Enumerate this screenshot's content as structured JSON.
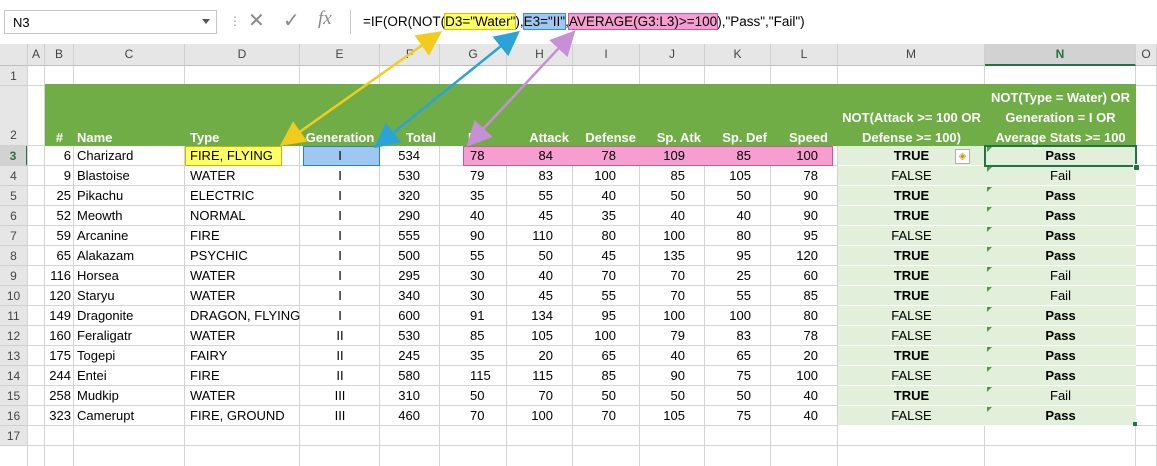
{
  "namebox": "N3",
  "formula": {
    "p0": "=IF(OR(NOT(",
    "p1": "D3=\"Water\"",
    "p2": "),",
    "p3": "E3=\"II\"",
    "p4": ",",
    "p5": "AVERAGE(G3:L3)>=100",
    "p6": "),\"Pass\",\"Fail\")"
  },
  "columns": [
    "A",
    "B",
    "C",
    "D",
    "E",
    "F",
    "G",
    "H",
    "I",
    "J",
    "K",
    "L",
    "M",
    "N",
    "O"
  ],
  "row_numbers": [
    "1",
    "2",
    "3",
    "4",
    "5",
    "6",
    "7",
    "8",
    "9",
    "10",
    "11",
    "12",
    "13",
    "14",
    "15",
    "16",
    "17"
  ],
  "headers": {
    "num": "#",
    "name": "Name",
    "type": "Type",
    "generation": "Generation",
    "total": "Total",
    "hp": "HP",
    "attack": "Attack",
    "defense": "Defense",
    "spatk": "Sp. Atk",
    "spdef": "Sp. Def",
    "speed": "Speed",
    "m_l1": "NOT(Attack >= 100 OR",
    "m_l2": "Defense >= 100)",
    "n_l1": "NOT(Type = Water) OR",
    "n_l2": "Generation = I OR",
    "n_l3": "Average Stats >= 100"
  },
  "rows": [
    {
      "num": "6",
      "name": "Charizard",
      "type": "FIRE, FLYING",
      "gen": "I",
      "total": "534",
      "hp": "78",
      "atk": "84",
      "def": "78",
      "spatk": "109",
      "spdef": "85",
      "speed": "100",
      "m": "TRUE",
      "n": "Pass"
    },
    {
      "num": "9",
      "name": "Blastoise",
      "type": "WATER",
      "gen": "I",
      "total": "530",
      "hp": "79",
      "atk": "83",
      "def": "100",
      "spatk": "85",
      "spdef": "105",
      "speed": "78",
      "m": "FALSE",
      "n": "Fail"
    },
    {
      "num": "25",
      "name": "Pikachu",
      "type": "ELECTRIC",
      "gen": "I",
      "total": "320",
      "hp": "35",
      "atk": "55",
      "def": "40",
      "spatk": "50",
      "spdef": "50",
      "speed": "90",
      "m": "TRUE",
      "n": "Pass"
    },
    {
      "num": "52",
      "name": "Meowth",
      "type": "NORMAL",
      "gen": "I",
      "total": "290",
      "hp": "40",
      "atk": "45",
      "def": "35",
      "spatk": "40",
      "spdef": "40",
      "speed": "90",
      "m": "TRUE",
      "n": "Pass"
    },
    {
      "num": "59",
      "name": "Arcanine",
      "type": "FIRE",
      "gen": "I",
      "total": "555",
      "hp": "90",
      "atk": "110",
      "def": "80",
      "spatk": "100",
      "spdef": "80",
      "speed": "95",
      "m": "FALSE",
      "n": "Pass"
    },
    {
      "num": "65",
      "name": "Alakazam",
      "type": "PSYCHIC",
      "gen": "I",
      "total": "500",
      "hp": "55",
      "atk": "50",
      "def": "45",
      "spatk": "135",
      "spdef": "95",
      "speed": "120",
      "m": "TRUE",
      "n": "Pass"
    },
    {
      "num": "116",
      "name": "Horsea",
      "type": "WATER",
      "gen": "I",
      "total": "295",
      "hp": "30",
      "atk": "40",
      "def": "70",
      "spatk": "70",
      "spdef": "25",
      "speed": "60",
      "m": "TRUE",
      "n": "Fail"
    },
    {
      "num": "120",
      "name": "Staryu",
      "type": "WATER",
      "gen": "I",
      "total": "340",
      "hp": "30",
      "atk": "45",
      "def": "55",
      "spatk": "70",
      "spdef": "55",
      "speed": "85",
      "m": "TRUE",
      "n": "Fail"
    },
    {
      "num": "149",
      "name": "Dragonite",
      "type": "DRAGON, FLYING",
      "gen": "I",
      "total": "600",
      "hp": "91",
      "atk": "134",
      "def": "95",
      "spatk": "100",
      "spdef": "100",
      "speed": "80",
      "m": "FALSE",
      "n": "Pass"
    },
    {
      "num": "160",
      "name": "Feraligatr",
      "type": "WATER",
      "gen": "II",
      "total": "530",
      "hp": "85",
      "atk": "105",
      "def": "100",
      "spatk": "79",
      "spdef": "83",
      "speed": "78",
      "m": "FALSE",
      "n": "Pass"
    },
    {
      "num": "175",
      "name": "Togepi",
      "type": "FAIRY",
      "gen": "II",
      "total": "245",
      "hp": "35",
      "atk": "20",
      "def": "65",
      "spatk": "40",
      "spdef": "65",
      "speed": "20",
      "m": "TRUE",
      "n": "Pass"
    },
    {
      "num": "244",
      "name": "Entei",
      "type": "FIRE",
      "gen": "II",
      "total": "580",
      "hp": "115",
      "atk": "115",
      "def": "85",
      "spatk": "90",
      "spdef": "75",
      "speed": "100",
      "m": "FALSE",
      "n": "Pass"
    },
    {
      "num": "258",
      "name": "Mudkip",
      "type": "WATER",
      "gen": "III",
      "total": "310",
      "hp": "50",
      "atk": "70",
      "def": "50",
      "spatk": "50",
      "spdef": "50",
      "speed": "40",
      "m": "TRUE",
      "n": "Fail"
    },
    {
      "num": "323",
      "name": "Camerupt",
      "type": "FIRE, GROUND",
      "gen": "III",
      "total": "460",
      "hp": "70",
      "atk": "100",
      "def": "70",
      "spatk": "105",
      "spdef": "75",
      "speed": "40",
      "m": "FALSE",
      "n": "Pass"
    }
  ],
  "colors": {
    "header_green": "#70ad47",
    "result_fill": "#e2efda",
    "yellow": "#ffff66",
    "blue": "#9fc7f2",
    "pink": "#f79ed0"
  }
}
